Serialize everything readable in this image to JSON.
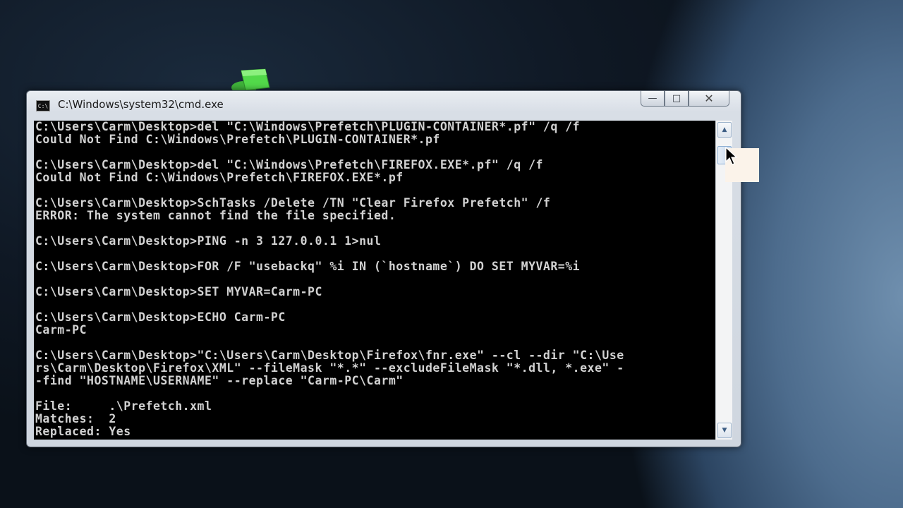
{
  "window": {
    "title": "C:\\Windows\\system32\\cmd.exe",
    "icon_label": "C:\\",
    "minimize_glyph": "—",
    "maximize_glyph": "□",
    "close_glyph": "✕"
  },
  "scrollbar": {
    "up_glyph": "▲",
    "down_glyph": "▼"
  },
  "console": {
    "lines": [
      "C:\\Users\\Carm\\Desktop>del \"C:\\Windows\\Prefetch\\PLUGIN-CONTAINER*.pf\" /q /f",
      "Could Not Find C:\\Windows\\Prefetch\\PLUGIN-CONTAINER*.pf",
      "",
      "C:\\Users\\Carm\\Desktop>del \"C:\\Windows\\Prefetch\\FIREFOX.EXE*.pf\" /q /f",
      "Could Not Find C:\\Windows\\Prefetch\\FIREFOX.EXE*.pf",
      "",
      "C:\\Users\\Carm\\Desktop>SchTasks /Delete /TN \"Clear Firefox Prefetch\" /f",
      "ERROR: The system cannot find the file specified.",
      "",
      "C:\\Users\\Carm\\Desktop>PING -n 3 127.0.0.1 1>nul",
      "",
      "C:\\Users\\Carm\\Desktop>FOR /F \"usebackq\" %i IN (`hostname`) DO SET MYVAR=%i",
      "",
      "C:\\Users\\Carm\\Desktop>SET MYVAR=Carm-PC",
      "",
      "C:\\Users\\Carm\\Desktop>ECHO Carm-PC",
      "Carm-PC",
      "",
      "C:\\Users\\Carm\\Desktop>\"C:\\Users\\Carm\\Desktop\\Firefox\\fnr.exe\" --cl --dir \"C:\\Use",
      "rs\\Carm\\Desktop\\Firefox\\XML\" --fileMask \"*.*\" --excludeFileMask \"*.dll, *.exe\" -",
      "-find \"HOSTNAME\\USERNAME\" --replace \"Carm-PC\\Carm\"",
      "",
      "File:     .\\Prefetch.xml",
      "Matches:  2",
      "Replaced: Yes"
    ]
  }
}
